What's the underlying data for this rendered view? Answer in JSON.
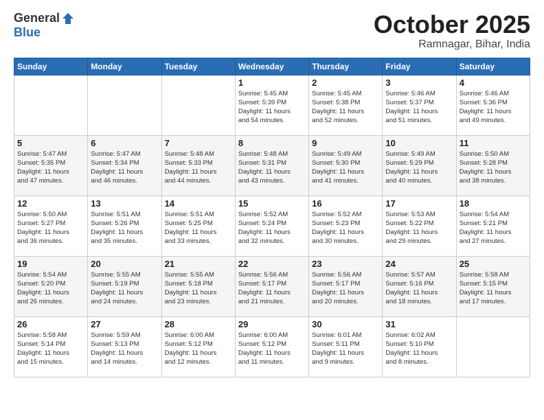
{
  "logo": {
    "general": "General",
    "blue": "Blue"
  },
  "header": {
    "month": "October 2025",
    "location": "Ramnagar, Bihar, India"
  },
  "weekdays": [
    "Sunday",
    "Monday",
    "Tuesday",
    "Wednesday",
    "Thursday",
    "Friday",
    "Saturday"
  ],
  "weeks": [
    [
      {
        "day": "",
        "info": ""
      },
      {
        "day": "",
        "info": ""
      },
      {
        "day": "",
        "info": ""
      },
      {
        "day": "1",
        "info": "Sunrise: 5:45 AM\nSunset: 5:39 PM\nDaylight: 11 hours\nand 54 minutes."
      },
      {
        "day": "2",
        "info": "Sunrise: 5:45 AM\nSunset: 5:38 PM\nDaylight: 11 hours\nand 52 minutes."
      },
      {
        "day": "3",
        "info": "Sunrise: 5:46 AM\nSunset: 5:37 PM\nDaylight: 11 hours\nand 51 minutes."
      },
      {
        "day": "4",
        "info": "Sunrise: 5:46 AM\nSunset: 5:36 PM\nDaylight: 11 hours\nand 49 minutes."
      }
    ],
    [
      {
        "day": "5",
        "info": "Sunrise: 5:47 AM\nSunset: 5:35 PM\nDaylight: 11 hours\nand 47 minutes."
      },
      {
        "day": "6",
        "info": "Sunrise: 5:47 AM\nSunset: 5:34 PM\nDaylight: 11 hours\nand 46 minutes."
      },
      {
        "day": "7",
        "info": "Sunrise: 5:48 AM\nSunset: 5:33 PM\nDaylight: 11 hours\nand 44 minutes."
      },
      {
        "day": "8",
        "info": "Sunrise: 5:48 AM\nSunset: 5:31 PM\nDaylight: 11 hours\nand 43 minutes."
      },
      {
        "day": "9",
        "info": "Sunrise: 5:49 AM\nSunset: 5:30 PM\nDaylight: 11 hours\nand 41 minutes."
      },
      {
        "day": "10",
        "info": "Sunrise: 5:49 AM\nSunset: 5:29 PM\nDaylight: 11 hours\nand 40 minutes."
      },
      {
        "day": "11",
        "info": "Sunrise: 5:50 AM\nSunset: 5:28 PM\nDaylight: 11 hours\nand 38 minutes."
      }
    ],
    [
      {
        "day": "12",
        "info": "Sunrise: 5:50 AM\nSunset: 5:27 PM\nDaylight: 11 hours\nand 36 minutes."
      },
      {
        "day": "13",
        "info": "Sunrise: 5:51 AM\nSunset: 5:26 PM\nDaylight: 11 hours\nand 35 minutes."
      },
      {
        "day": "14",
        "info": "Sunrise: 5:51 AM\nSunset: 5:25 PM\nDaylight: 11 hours\nand 33 minutes."
      },
      {
        "day": "15",
        "info": "Sunrise: 5:52 AM\nSunset: 5:24 PM\nDaylight: 11 hours\nand 32 minutes."
      },
      {
        "day": "16",
        "info": "Sunrise: 5:52 AM\nSunset: 5:23 PM\nDaylight: 11 hours\nand 30 minutes."
      },
      {
        "day": "17",
        "info": "Sunrise: 5:53 AM\nSunset: 5:22 PM\nDaylight: 11 hours\nand 29 minutes."
      },
      {
        "day": "18",
        "info": "Sunrise: 5:54 AM\nSunset: 5:21 PM\nDaylight: 11 hours\nand 27 minutes."
      }
    ],
    [
      {
        "day": "19",
        "info": "Sunrise: 5:54 AM\nSunset: 5:20 PM\nDaylight: 11 hours\nand 26 minutes."
      },
      {
        "day": "20",
        "info": "Sunrise: 5:55 AM\nSunset: 5:19 PM\nDaylight: 11 hours\nand 24 minutes."
      },
      {
        "day": "21",
        "info": "Sunrise: 5:55 AM\nSunset: 5:18 PM\nDaylight: 11 hours\nand 23 minutes."
      },
      {
        "day": "22",
        "info": "Sunrise: 5:56 AM\nSunset: 5:17 PM\nDaylight: 11 hours\nand 21 minutes."
      },
      {
        "day": "23",
        "info": "Sunrise: 5:56 AM\nSunset: 5:17 PM\nDaylight: 11 hours\nand 20 minutes."
      },
      {
        "day": "24",
        "info": "Sunrise: 5:57 AM\nSunset: 5:16 PM\nDaylight: 11 hours\nand 18 minutes."
      },
      {
        "day": "25",
        "info": "Sunrise: 5:58 AM\nSunset: 5:15 PM\nDaylight: 11 hours\nand 17 minutes."
      }
    ],
    [
      {
        "day": "26",
        "info": "Sunrise: 5:58 AM\nSunset: 5:14 PM\nDaylight: 11 hours\nand 15 minutes."
      },
      {
        "day": "27",
        "info": "Sunrise: 5:59 AM\nSunset: 5:13 PM\nDaylight: 11 hours\nand 14 minutes."
      },
      {
        "day": "28",
        "info": "Sunrise: 6:00 AM\nSunset: 5:12 PM\nDaylight: 11 hours\nand 12 minutes."
      },
      {
        "day": "29",
        "info": "Sunrise: 6:00 AM\nSunset: 5:12 PM\nDaylight: 11 hours\nand 11 minutes."
      },
      {
        "day": "30",
        "info": "Sunrise: 6:01 AM\nSunset: 5:11 PM\nDaylight: 11 hours\nand 9 minutes."
      },
      {
        "day": "31",
        "info": "Sunrise: 6:02 AM\nSunset: 5:10 PM\nDaylight: 11 hours\nand 8 minutes."
      },
      {
        "day": "",
        "info": ""
      }
    ]
  ]
}
